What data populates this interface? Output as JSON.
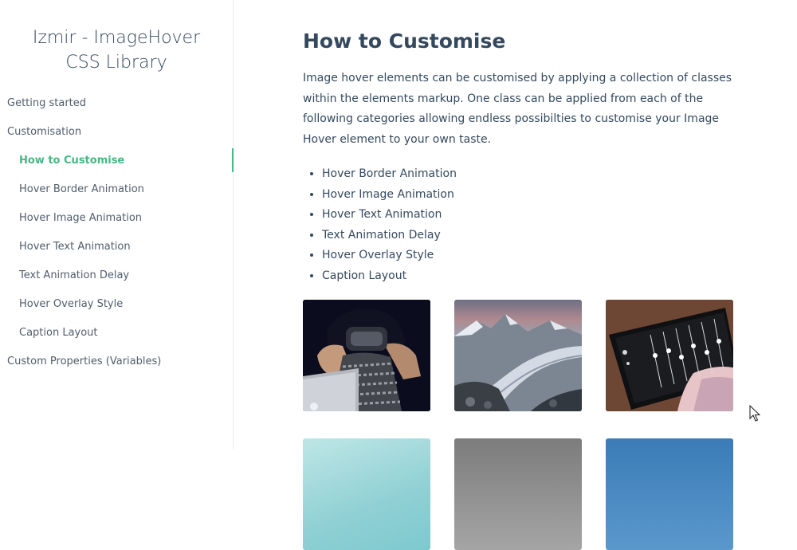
{
  "sidebar": {
    "title_line1": "Izmir - ImageHover",
    "title_line2": "CSS Library",
    "nav": [
      {
        "label": "Getting started"
      },
      {
        "label": "Customisation"
      },
      {
        "label": "How to Customise"
      },
      {
        "label": "Hover Border Animation"
      },
      {
        "label": "Hover Image Animation"
      },
      {
        "label": "Hover Text Animation"
      },
      {
        "label": "Text Animation Delay"
      },
      {
        "label": "Hover Overlay Style"
      },
      {
        "label": "Caption Layout"
      },
      {
        "label": "Custom Properties (Variables)"
      }
    ]
  },
  "main": {
    "title": "How to Customise",
    "intro": "Image hover elements can be customised by applying a collection of classes within the elements markup. One class can be applied from each of the following categories allowing endless possibilties to customise your Image Hover element to your own taste.",
    "categories": [
      "Hover Border Animation",
      "Hover Image Animation",
      "Hover Text Animation",
      "Text Animation Delay",
      "Hover Overlay Style",
      "Caption Layout"
    ]
  },
  "colors": {
    "accent": "#42b983",
    "text": "#34495e"
  }
}
